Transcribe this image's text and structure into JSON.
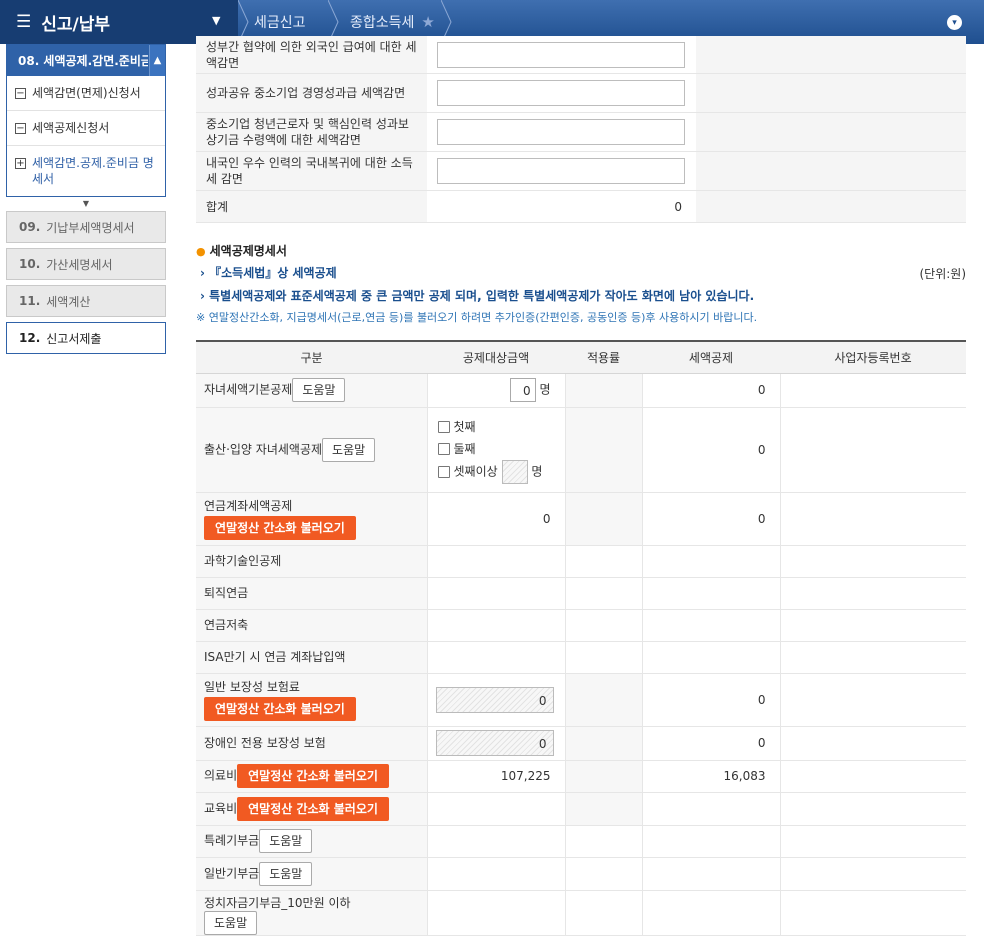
{
  "header": {
    "menu_title": "신고/납부",
    "crumb1": "세금신고",
    "crumb2": "종합소득세"
  },
  "sidebar": {
    "section_title": "08. 세액공제.감면.준비금",
    "sub_items": [
      "세액감면(면제)신청서",
      "세액공제신청서",
      "세액감면.공제.준비금 명세서"
    ],
    "nav": [
      {
        "num": "09.",
        "label": "기납부세액명세서"
      },
      {
        "num": "10.",
        "label": "가산세명세서"
      },
      {
        "num": "11.",
        "label": "세액계산"
      },
      {
        "num": "12.",
        "label": "신고서제출"
      }
    ]
  },
  "top_rows": [
    "성부간 협약에 의한 외국인 급여에 대한 세액감면",
    "성과공유 중소기업 경영성과급 세액감면",
    "중소기업 청년근로자 및 핵심인력 성과보상기금 수령액에 대한 세액감면",
    "내국인 우수 인력의 국내복귀에 대한 소득세 감면"
  ],
  "total_row": {
    "label": "합계",
    "value": "0"
  },
  "section": {
    "title": "세액공제명세서",
    "line1": "『소득세법』상 세액공제",
    "unit": "(단위:원)",
    "line2": "특별세액공제와 표준세액공제 중 큰 금액만 공제 되며, 입력한 특별세액공제가 작아도 화면에 남아 있습니다.",
    "note": "※ 연말정산간소화, 지급명세서(근로,연금 등)를 불러오기 하려면 추가인증(간편인증, 공동인증 등)후 사용하시기 바랍니다."
  },
  "table": {
    "headers": [
      "구분",
      "공제대상금액",
      "적용률",
      "세액공제",
      "사업자등록번호"
    ],
    "help": "도움말",
    "load_btn": "연말정산 간소화 불러오기",
    "unit_person": "명",
    "rows": {
      "child": {
        "label": "자녀세액기본공제",
        "count": "0",
        "credit": "0"
      },
      "birth": {
        "label": "출산·입양 자녀세액공제",
        "opt1": "첫째",
        "opt2": "둘째",
        "opt3": "셋째이상",
        "credit": "0"
      },
      "pension": {
        "label": "연금계좌세액공제",
        "amount": "0",
        "credit": "0"
      },
      "science": {
        "label": "과학기술인공제"
      },
      "retire": {
        "label": "퇴직연금"
      },
      "savings": {
        "label": "연금저축"
      },
      "isa": {
        "label": "ISA만기 시 연금 계좌납입액"
      },
      "insurance": {
        "label": "일반 보장성 보험료",
        "amount": "0",
        "credit": "0"
      },
      "disabled_ins": {
        "label": "장애인 전용 보장성 보험",
        "amount": "0",
        "credit": "0"
      },
      "medical": {
        "label": "의료비",
        "amount": "107,225",
        "credit": "16,083"
      },
      "education": {
        "label": "교육비"
      },
      "special_donation": {
        "label": "특례기부금"
      },
      "general_donation": {
        "label": "일반기부금"
      },
      "political": {
        "label": "정치자금기부금_10만원 이하"
      }
    }
  }
}
